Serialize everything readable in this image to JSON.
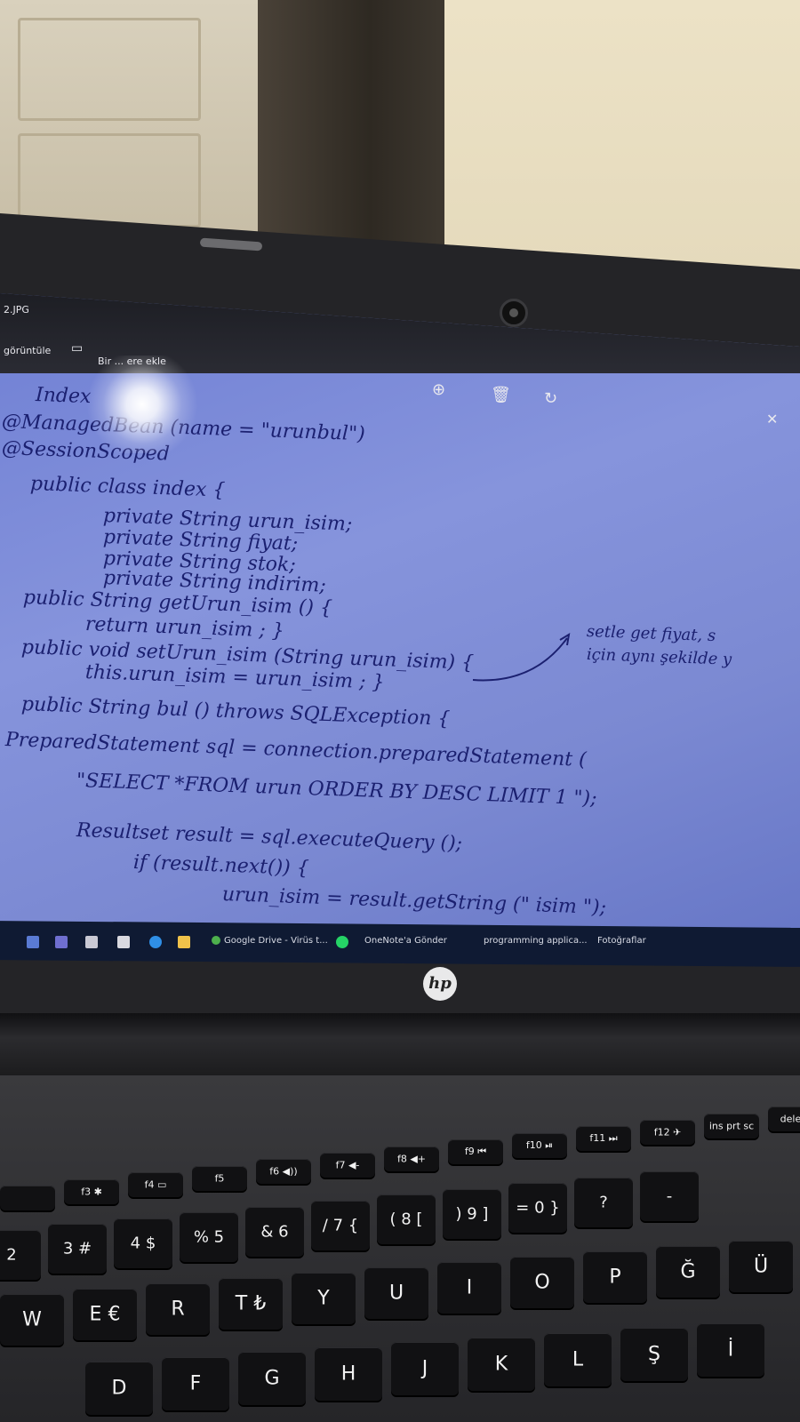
{
  "titlebar": {
    "filename": "2.JPG",
    "view_button": "görüntüle",
    "add_button": "Bir ... ere ekle",
    "zoom_icon": "zoom-in-icon",
    "delete_icon": "trash-icon",
    "rotate_icon": "rotate-icon"
  },
  "notes": [
    "Index",
    "@ManagedBean (name = \"urunbul\")",
    "@SessionScoped",
    "public class index {",
    "private String urun_isim;",
    "private String fiyat;",
    "private String stok;",
    "private String indirim;",
    "public String getUrun_isim () {",
    "return urun_isim ; }",
    "public void setUrun_isim (String urun_isim) {",
    "this.urun_isim = urun_isim ; }",
    "public String bul () throws SQLException {",
    "PreparedStatement sql = connection.preparedStatement (",
    "\"SELECT *FROM urun ORDER BY DESC LIMIT 1 \");",
    "Resultset result = sql.executeQuery ();",
    "if (result.next()) {",
    "urun_isim = result.getString (\" isim \");"
  ],
  "side_note": [
    "setle get fiyat, s",
    "için aynı şekilde y"
  ],
  "taskbar": {
    "items": [
      "Google Drive - Virüs t...",
      "OneNote'a Gönder",
      "programming applica...",
      "Fotoğraflar"
    ]
  },
  "brand": "hp",
  "keys": {
    "fn_row": [
      "",
      "f3 ✱",
      "f4 ▭",
      "f5",
      "f6 ◀))",
      "f7 ◀-",
      "f8 ◀+",
      "f9 ⏮",
      "f10 ⏯",
      "f11 ⏭",
      "f12 ✈",
      "ins prt sc",
      "delete"
    ],
    "num_row": [
      "2",
      "3 #",
      "4 $",
      "% 5",
      "& 6",
      "/ 7 {",
      "( 8 [",
      ") 9 ]",
      "= 0 }",
      "?",
      "-"
    ],
    "top_row": [
      "W",
      "E €",
      "R",
      "T ₺",
      "Y",
      "U",
      "I",
      "O",
      "P",
      "Ğ",
      "Ü"
    ],
    "mid_row": [
      "D",
      "F",
      "G",
      "H",
      "J",
      "K",
      "L",
      "Ş",
      "İ"
    ]
  },
  "colors": {
    "screen": "#7b89d2",
    "ink": "#1b2070",
    "bezel": "#242427"
  }
}
